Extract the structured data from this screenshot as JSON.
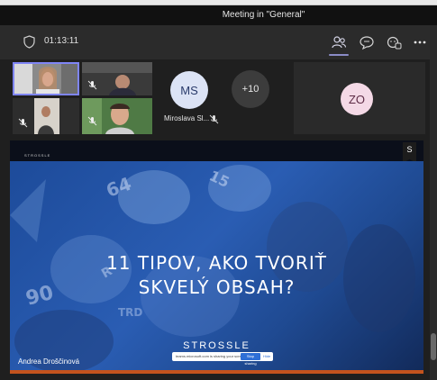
{
  "window": {
    "title": "Meeting in \"General\""
  },
  "toolbar": {
    "timer": "01:13:11",
    "icons": [
      "shield-icon",
      "people-icon",
      "chat-icon",
      "reactions-icon",
      "more-icon"
    ]
  },
  "participants": {
    "ms_initials": "MS",
    "ms_name": "Miroslava Sl...",
    "more_count": "+10",
    "zo_initials": "ZO"
  },
  "slide": {
    "brand_small": "STROSSLE",
    "badge": "S",
    "headline_line1": "11 TIPOV, AKO TVORIŤ",
    "headline_line2": "SKVELÝ OBSAH?",
    "brand_large": "STROSSLE",
    "share_message": "teams.microsoft.com is sharing your screen.",
    "stop_sharing": "Stop sharing",
    "hide": "Hide",
    "presenter": "Andrea Droščinová"
  },
  "colors": {
    "accent": "#7f85f5",
    "toolbar_bg": "#2b2b2b",
    "slide_blue": "#2a5db3"
  }
}
